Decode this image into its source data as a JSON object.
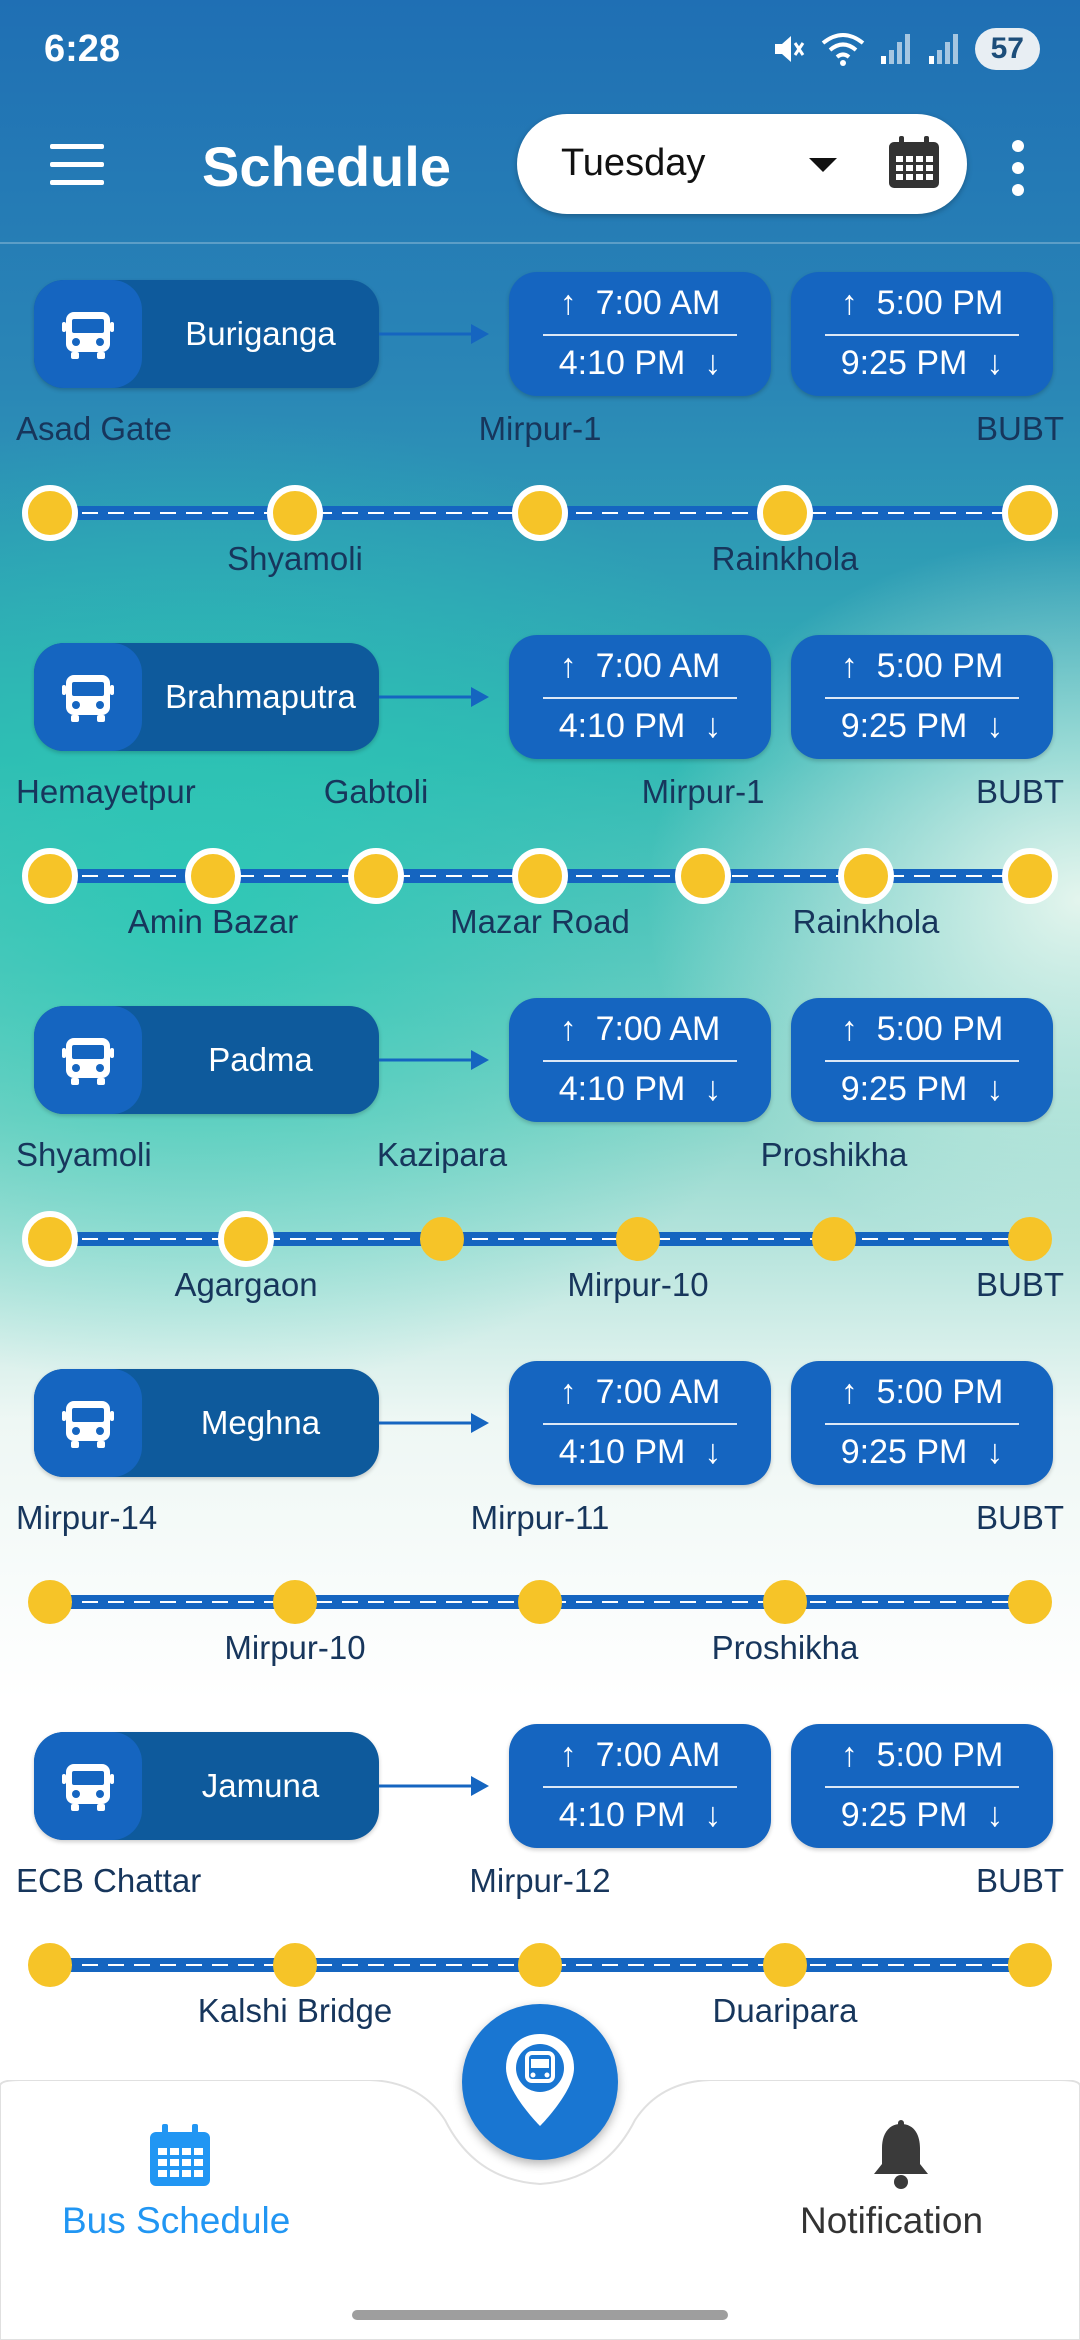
{
  "status_bar": {
    "time": "6:28",
    "battery": "57"
  },
  "header": {
    "title": "Schedule",
    "selected_day": "Tuesday"
  },
  "routes": [
    {
      "bus": "Buriganga",
      "times": [
        {
          "up": "7:00 AM",
          "down": "4:10 PM"
        },
        {
          "up": "5:00 PM",
          "down": "9:25 PM"
        }
      ],
      "stops": [
        "Asad Gate",
        "Shyamoli",
        "Mirpur-1",
        "Rainkhola",
        "BUBT"
      ]
    },
    {
      "bus": "Brahmaputra",
      "times": [
        {
          "up": "7:00 AM",
          "down": "4:10 PM"
        },
        {
          "up": "5:00 PM",
          "down": "9:25 PM"
        }
      ],
      "stops": [
        "Hemayetpur",
        "Amin Bazar",
        "Gabtoli",
        "Mazar Road",
        "Mirpur-1",
        "Rainkhola",
        "BUBT"
      ]
    },
    {
      "bus": "Padma",
      "times": [
        {
          "up": "7:00 AM",
          "down": "4:10 PM"
        },
        {
          "up": "5:00 PM",
          "down": "9:25 PM"
        }
      ],
      "stops": [
        "Shyamoli",
        "Agargaon",
        "Kazipara",
        "Mirpur-10",
        "Proshikha",
        "BUBT"
      ]
    },
    {
      "bus": "Meghna",
      "times": [
        {
          "up": "7:00 AM",
          "down": "4:10 PM"
        },
        {
          "up": "5:00 PM",
          "down": "9:25 PM"
        }
      ],
      "stops": [
        "Mirpur-14",
        "Mirpur-10",
        "Mirpur-11",
        "Proshikha",
        "BUBT"
      ]
    },
    {
      "bus": "Jamuna",
      "times": [
        {
          "up": "7:00 AM",
          "down": "4:10 PM"
        },
        {
          "up": "5:00 PM",
          "down": "9:25 PM"
        }
      ],
      "stops": [
        "ECB Chattar",
        "Kalshi Bridge",
        "Mirpur-12",
        "Duaripara",
        "BUBT"
      ]
    }
  ],
  "bottom_nav": {
    "schedule_label": "Bus Schedule",
    "notification_label": "Notification"
  },
  "colors": {
    "primary": "#1565C0",
    "bus_pill": "#0E5A9C",
    "stop_dot": "#F6C428",
    "active_nav": "#2196F3"
  },
  "icons": {
    "menu": "hamburger-icon",
    "calendar": "calendar-icon",
    "more": "more-vert-icon",
    "bus": "bus-icon",
    "fab": "bus-location-icon",
    "notification": "bell-icon"
  }
}
